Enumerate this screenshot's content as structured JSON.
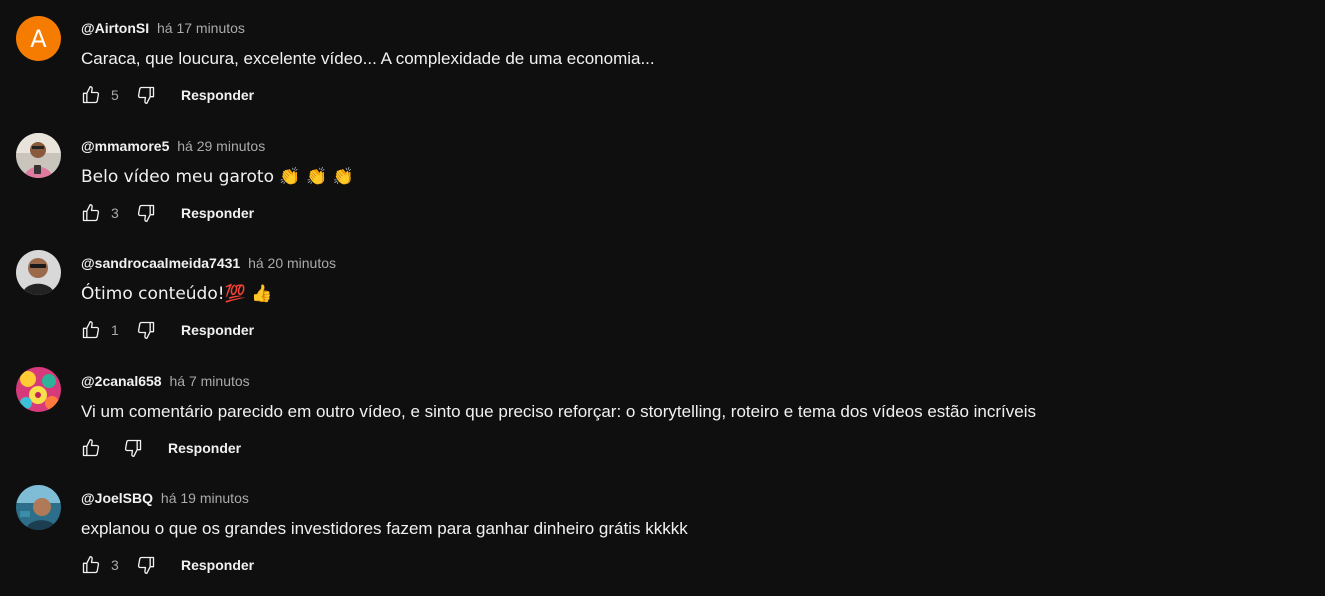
{
  "comments": [
    {
      "author": "@AirtonSI",
      "time": "há 17 minutos",
      "text": "Caraca, que loucura, excelente vídeo... A complexidade de uma economia...",
      "likes": "5",
      "avatar_letter": "A",
      "avatar_color": "#f57c00",
      "reply_label": "Responder"
    },
    {
      "author": "@mmamore5",
      "time": "há 29 minutos",
      "text": "Belo vídeo meu garoto 👏 👏 👏",
      "likes": "3",
      "reply_label": "Responder"
    },
    {
      "author": "@sandrocaalmeida7431",
      "time": "há 20 minutos",
      "text": "Ótimo conteúdo!💯 👍",
      "likes": "1",
      "reply_label": "Responder"
    },
    {
      "author": "@2canal658",
      "time": "há 7 minutos",
      "text": "Vi um comentário parecido em outro vídeo, e sinto que preciso reforçar: o storytelling, roteiro e tema dos vídeos estão incríveis",
      "likes": "",
      "reply_label": "Responder"
    },
    {
      "author": "@JoelSBQ",
      "time": "há 19 minutos",
      "text": "explanou o que os grandes investidores fazem para ganhar dinheiro grátis kkkkk",
      "likes": "3",
      "reply_label": "Responder"
    }
  ],
  "icons": {
    "like": "thumbs-up-icon",
    "dislike": "thumbs-down-icon"
  },
  "colors": {
    "background": "#0f0f0f",
    "primary_text": "#f1f1f1",
    "secondary_text": "#aaaaaa"
  }
}
